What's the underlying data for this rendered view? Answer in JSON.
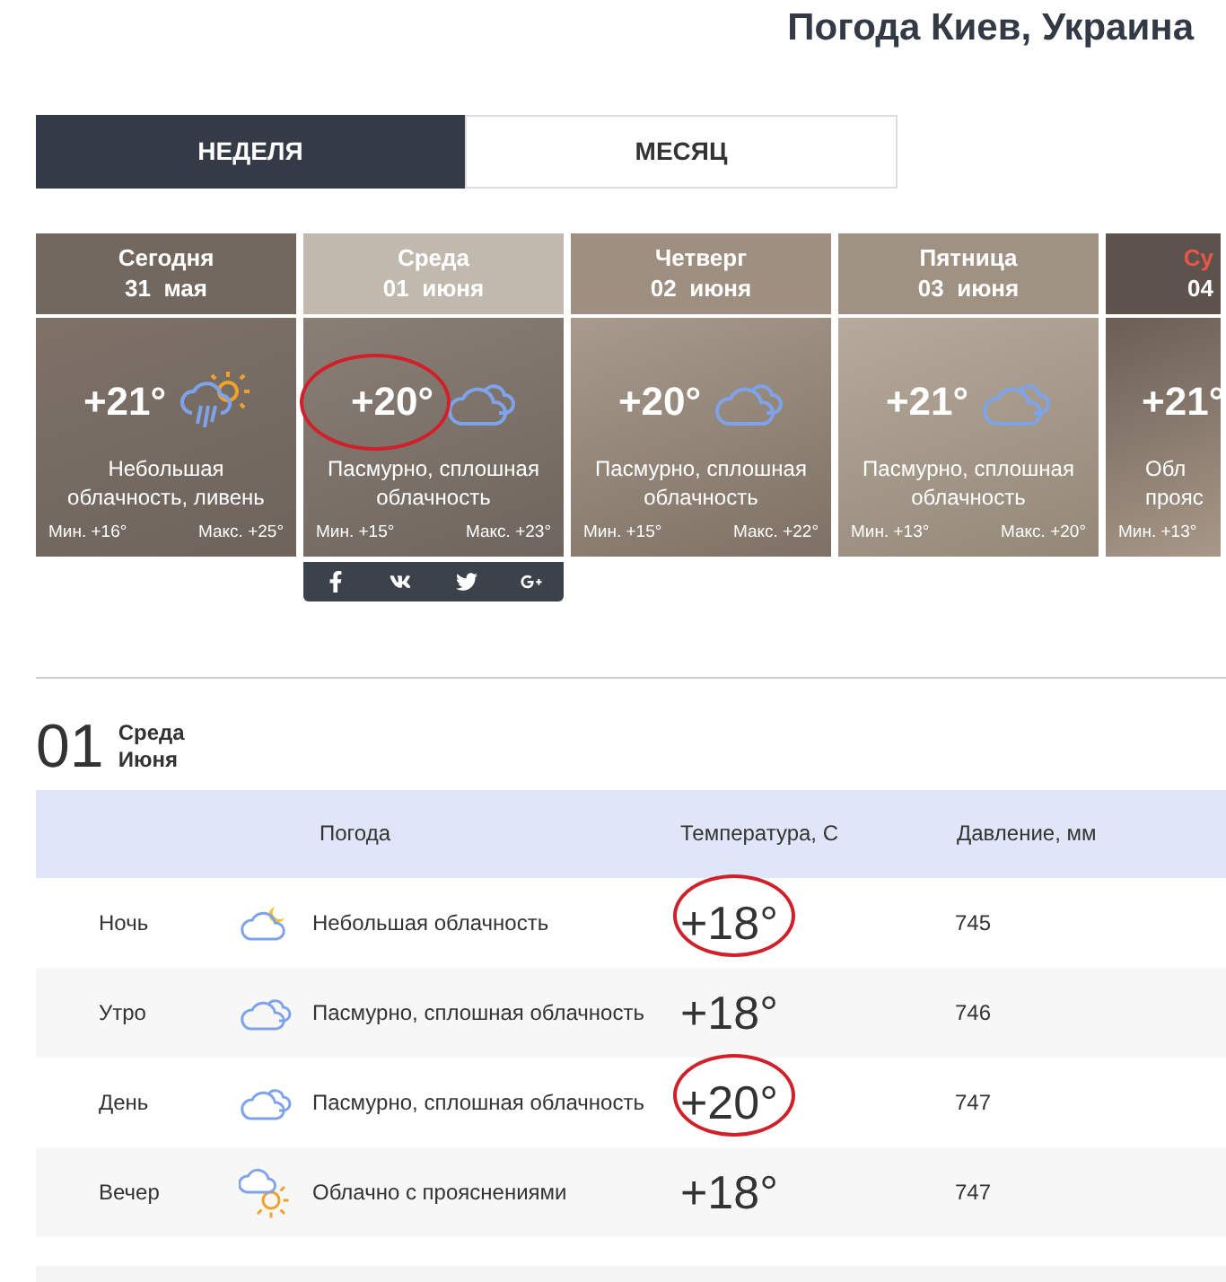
{
  "title": "Погода Киев, Украина",
  "tabs": [
    {
      "label": "НЕДЕЛЯ",
      "selected": true
    },
    {
      "label": "МЕСЯЦ",
      "selected": false
    }
  ],
  "days": [
    {
      "day": "Сегодня",
      "date": "31  мая",
      "weekend": false,
      "temp": "+21°",
      "kind": "rain",
      "desc": "Небольшая облачность, ливень",
      "min": "Мин. +16°",
      "max": "Макс. +25°",
      "selected": false,
      "circled": false,
      "clipped": false
    },
    {
      "day": "Среда",
      "date": "01  июня",
      "weekend": false,
      "temp": "+20°",
      "kind": "cloudy",
      "desc": "Пасмурно, сплошная облачность",
      "min": "Мин. +15°",
      "max": "Макс. +23°",
      "selected": true,
      "circled": true,
      "clipped": false
    },
    {
      "day": "Четверг",
      "date": "02  июня",
      "weekend": false,
      "temp": "+20°",
      "kind": "cloudy",
      "desc": "Пасмурно, сплошная облачность",
      "min": "Мин. +15°",
      "max": "Макс. +22°",
      "selected": false,
      "circled": false,
      "clipped": false
    },
    {
      "day": "Пятница",
      "date": "03  июня",
      "weekend": false,
      "temp": "+21°",
      "kind": "cloudy",
      "desc": "Пасмурно, сплошная облачность",
      "min": "Мин. +13°",
      "max": "Макс. +20°",
      "selected": false,
      "circled": false,
      "clipped": false
    },
    {
      "day": "Су",
      "date": "04",
      "weekend": true,
      "temp": "+21°",
      "kind": "none",
      "desc": "Обл прояс",
      "min": "Мин. +13°",
      "selected": false,
      "circled": false,
      "clipped": true
    }
  ],
  "detail": {
    "day_number": "01",
    "weekday": "Среда",
    "month": "Июня",
    "columns": [
      "Погода",
      "Температура, С",
      "Давление, мм"
    ],
    "rows": [
      {
        "period": "Ночь",
        "kind": "night",
        "weather": "Небольшая облачность",
        "temp": "+18°",
        "pressure": "745",
        "circled": true
      },
      {
        "period": "Утро",
        "kind": "cloudy",
        "weather": "Пасмурно, сплошная облачность",
        "temp": "+18°",
        "pressure": "746",
        "circled": false
      },
      {
        "period": "День",
        "kind": "cloudy",
        "weather": "Пасмурно, сплошная облачность",
        "temp": "+20°",
        "pressure": "747",
        "circled": true
      },
      {
        "period": "Вечер",
        "kind": "partly",
        "weather": "Облачно с прояснениями",
        "temp": "+18°",
        "pressure": "747",
        "circled": false
      }
    ]
  }
}
